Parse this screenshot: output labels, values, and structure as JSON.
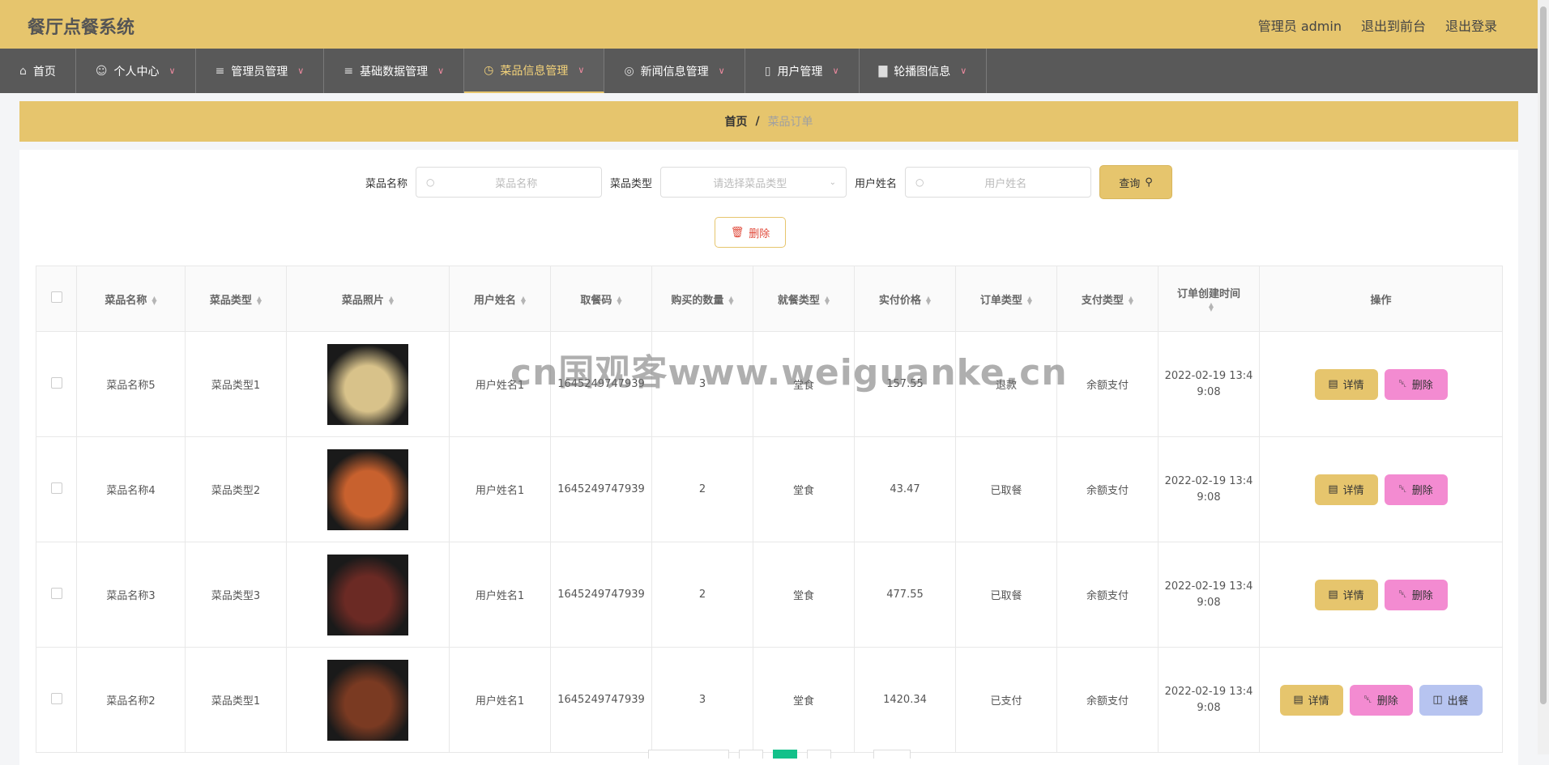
{
  "header": {
    "title": "餐厅点餐系统",
    "admin_label": "管理员 admin",
    "frontend_link": "退出到前台",
    "logout_link": "退出登录"
  },
  "nav": [
    {
      "label": "首页",
      "icon": "home-icon",
      "active": false,
      "dropdown": false
    },
    {
      "label": "个人中心",
      "icon": "user-icon",
      "active": false,
      "dropdown": true
    },
    {
      "label": "管理员管理",
      "icon": "list-icon",
      "active": false,
      "dropdown": true
    },
    {
      "label": "基础数据管理",
      "icon": "list-icon",
      "active": false,
      "dropdown": true
    },
    {
      "label": "菜品信息管理",
      "icon": "clock-icon",
      "active": true,
      "dropdown": true
    },
    {
      "label": "新闻信息管理",
      "icon": "globe-icon",
      "active": false,
      "dropdown": true
    },
    {
      "label": "用户管理",
      "icon": "mic-icon",
      "active": false,
      "dropdown": true
    },
    {
      "label": "轮播图信息",
      "icon": "bar-chart-icon",
      "active": false,
      "dropdown": true
    }
  ],
  "breadcrumb": {
    "home": "首页",
    "separator": "/",
    "current": "菜品订单"
  },
  "search": {
    "dish_name_label": "菜品名称",
    "dish_name_placeholder": "菜品名称",
    "dish_type_label": "菜品类型",
    "dish_type_placeholder": "请选择菜品类型",
    "user_name_label": "用户姓名",
    "user_name_placeholder": "用户姓名",
    "query_button": "查询"
  },
  "bulk_delete_button": "删除",
  "table": {
    "columns": [
      "菜品名称",
      "菜品类型",
      "菜品照片",
      "用户姓名",
      "取餐码",
      "购买的数量",
      "就餐类型",
      "实付价格",
      "订单类型",
      "支付类型",
      "订单创建时间",
      "操作"
    ],
    "rows": [
      {
        "name": "菜品名称5",
        "type": "菜品类型1",
        "user": "用户姓名1",
        "code": "1645249747939",
        "qty": "3",
        "dine": "堂食",
        "price": "157.55",
        "order_type": "退款",
        "pay_type": "余额支付",
        "created": "2022-02-19 13:49:08",
        "actions": [
          "详情",
          "删除"
        ],
        "photo_color": "#d8c28a"
      },
      {
        "name": "菜品名称4",
        "type": "菜品类型2",
        "user": "用户姓名1",
        "code": "1645249747939",
        "qty": "2",
        "dine": "堂食",
        "price": "43.47",
        "order_type": "已取餐",
        "pay_type": "余额支付",
        "created": "2022-02-19 13:49:08",
        "actions": [
          "详情",
          "删除"
        ],
        "photo_color": "#c8612e"
      },
      {
        "name": "菜品名称3",
        "type": "菜品类型3",
        "user": "用户姓名1",
        "code": "1645249747939",
        "qty": "2",
        "dine": "堂食",
        "price": "477.55",
        "order_type": "已取餐",
        "pay_type": "余额支付",
        "created": "2022-02-19 13:49:08",
        "actions": [
          "详情",
          "删除"
        ],
        "photo_color": "#6b2a24"
      },
      {
        "name": "菜品名称2",
        "type": "菜品类型1",
        "user": "用户姓名1",
        "code": "1645249747939",
        "qty": "3",
        "dine": "堂食",
        "price": "1420.34",
        "order_type": "已支付",
        "pay_type": "余额支付",
        "created": "2022-02-19 13:49:08",
        "actions": [
          "详情",
          "删除",
          "出餐"
        ],
        "photo_color": "#7a3a22"
      }
    ]
  },
  "watermark": "cn国观客www.weiguanke.cn"
}
